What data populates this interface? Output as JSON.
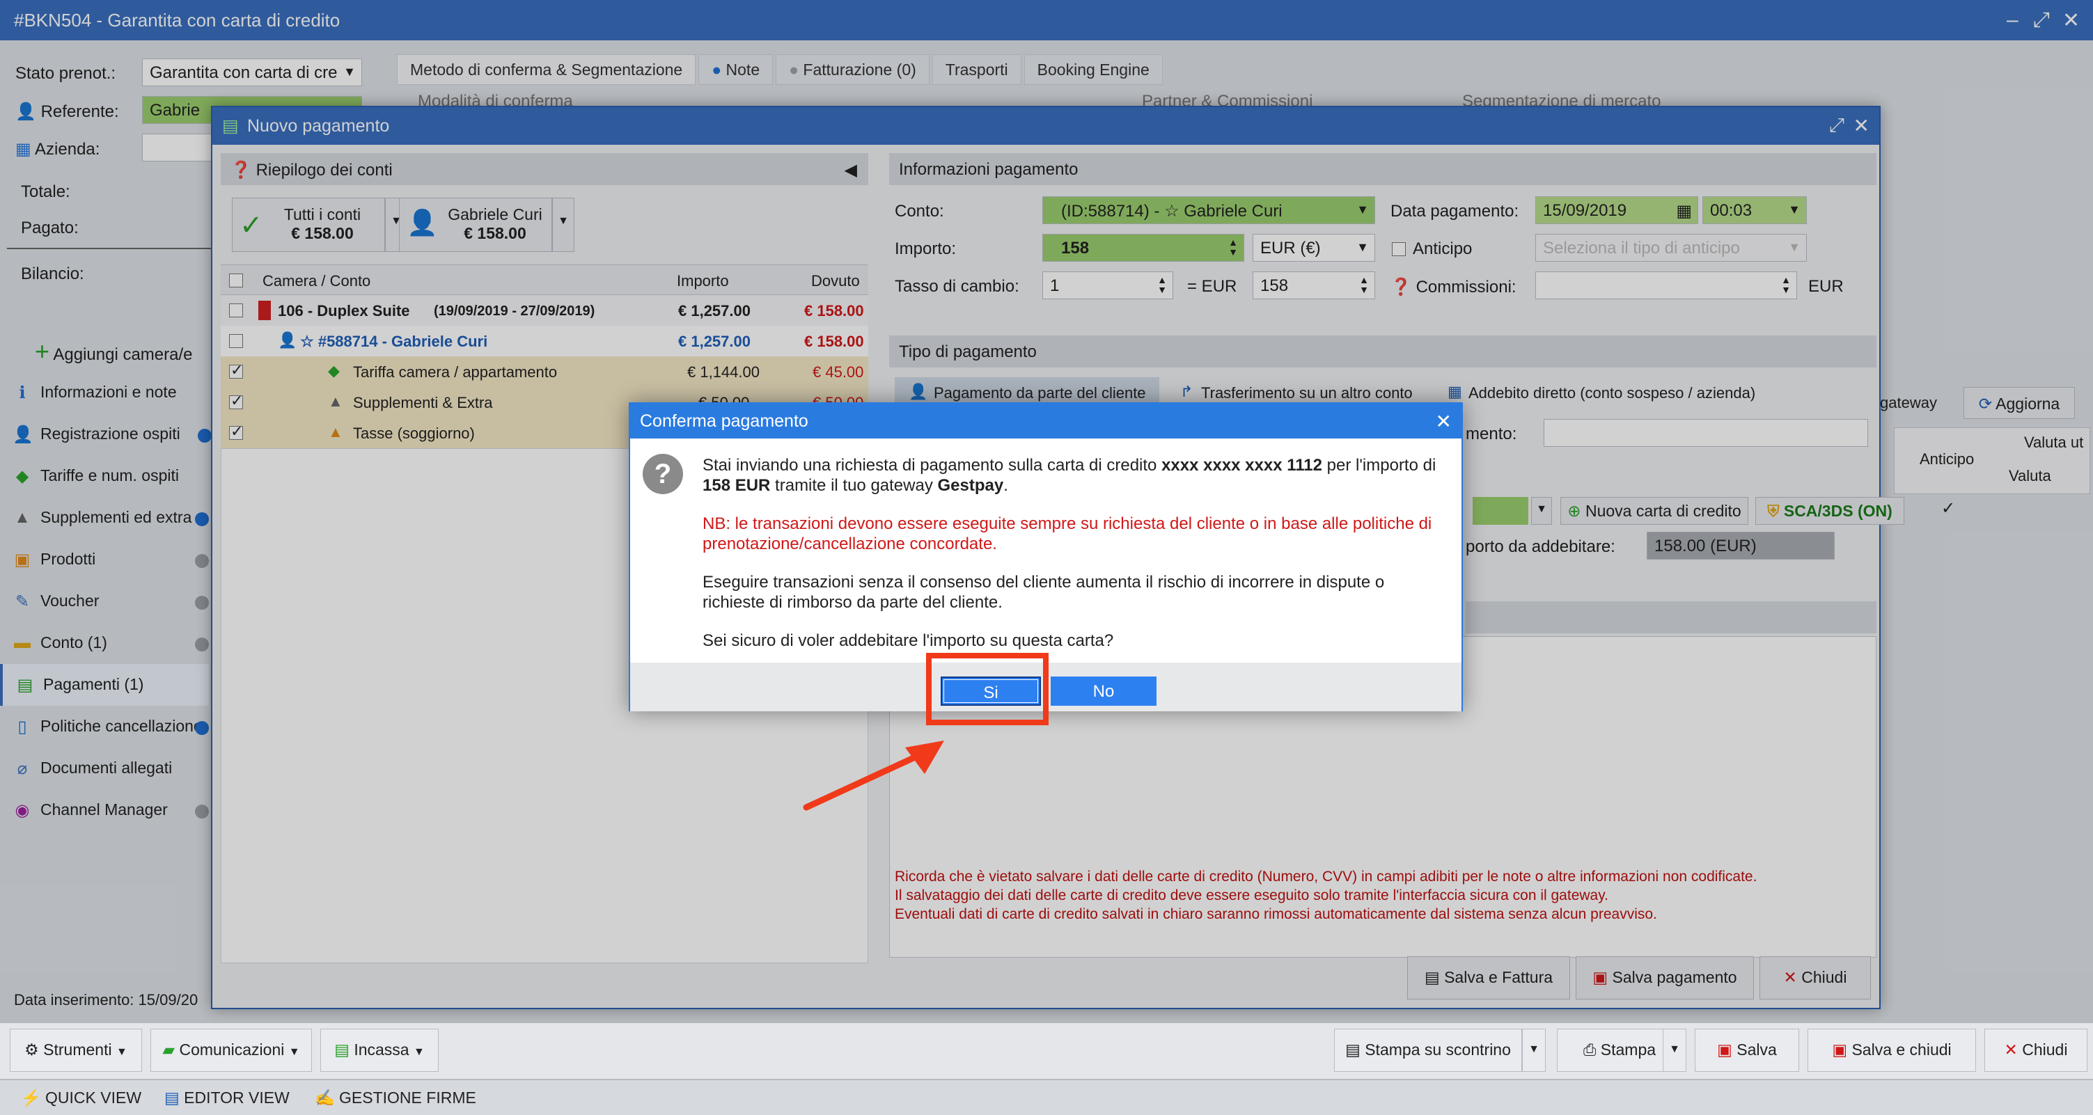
{
  "window": {
    "title": "#BKN504 - Garantita con carta di credito"
  },
  "booking": {
    "stato_label": "Stato prenot.:",
    "stato_value": "Garantita con carta di cre",
    "referente_label": "Referente:",
    "referente_value": "Gabrie",
    "azienda_label": "Azienda:",
    "totale_label": "Totale:",
    "pagato_label": "Pagato:",
    "bilancio_label": "Bilancio:",
    "add_room": "Aggiungi camera/e",
    "data_ins_label": "Data inserimento:",
    "data_ins_value": "15/09/20"
  },
  "tabs": [
    "Metodo di conferma & Segmentazione",
    "Note",
    "Fatturazione (0)",
    "Trasporti",
    "Booking Engine"
  ],
  "bg_sections": {
    "modalita": "Modalità di conferma",
    "partner": "Partner & Commissioni",
    "segmentazione": "Segmentazione di mercato"
  },
  "sidebar": [
    {
      "label": "Informazioni e note"
    },
    {
      "label": "Registrazione ospiti"
    },
    {
      "label": "Tariffe e num. ospiti"
    },
    {
      "label": "Supplementi ed extra"
    },
    {
      "label": "Prodotti"
    },
    {
      "label": "Voucher"
    },
    {
      "label": "Conto (1)"
    },
    {
      "label": "Pagamenti (1)"
    },
    {
      "label": "Politiche cancellazione"
    },
    {
      "label": "Documenti allegati"
    },
    {
      "label": "Channel Manager"
    }
  ],
  "modal": {
    "title": "Nuovo pagamento",
    "riepilogo": "Riepilogo dei conti",
    "tutti": {
      "label": "Tutti i conti",
      "amount": "€ 158.00"
    },
    "gabriele": {
      "label": "Gabriele Curi",
      "amount": "€ 158.00"
    },
    "table_headers": [
      "Camera / Conto",
      "Importo",
      "Dovuto"
    ],
    "rows": [
      {
        "name": "106 - Duplex Suite",
        "dates": "(19/09/2019 - 27/09/2019)",
        "importo": "€ 1,257.00",
        "dovuto": "€ 158.00"
      },
      {
        "name": "☆ #588714 - Gabriele Curi",
        "importo": "€ 1,257.00",
        "dovuto": "€ 158.00"
      },
      {
        "name": "Tariffa camera / appartamento",
        "importo": "€ 1,144.00",
        "dovuto": "€ 45.00"
      },
      {
        "name": "Supplementi & Extra",
        "importo": "€ 50.00",
        "dovuto": "€ 50.00"
      },
      {
        "name": "Tasse (soggiorno)",
        "importo": "",
        "dovuto": ""
      }
    ],
    "info_head": "Informazioni pagamento",
    "conto_label": "Conto:",
    "conto_value": "(ID:588714) - ☆ Gabriele Curi",
    "data_label": "Data pagamento:",
    "data_value": "15/09/2019",
    "time_value": "00:03",
    "importo_label": "Importo:",
    "importo_value": "158",
    "currency": "EUR (€)",
    "anticipo_label": "Anticipo",
    "anticipo_placeholder": "Seleziona il tipo di anticipo",
    "tasso_label": "Tasso di cambio:",
    "tasso_value": "1",
    "eq_eur": "= EUR",
    "tasso_result": "158",
    "commissioni_label": "Commissioni:",
    "commissioni_unit": "EUR",
    "tipo_head": "Tipo di pagamento",
    "pay_tabs": [
      "Pagamento da parte del cliente",
      "Trasferimento su un altro conto",
      "Addebito diretto (conto sospeso / azienda)"
    ],
    "gateway": "gateway",
    "aggiorna": "Aggiorna",
    "mento_label": "mento:",
    "col_anticipo": "Anticipo",
    "col_valuta_ut": "Valuta ut",
    "col_valuta": "Valuta",
    "check_mark": "✓",
    "nuova_carta": "Nuova carta di credito",
    "sca": "SCA/3DS (ON)",
    "addebitare_label": "porto da addebitare:",
    "addebitare_value": "158.00 (EUR)",
    "warning_lines": [
      "Ricorda che è vietato salvare i dati delle carte di credito (Numero, CVV) in campi adibiti per le note o altre informazioni non codificate.",
      "Il salvataggio dei dati delle carte di credito deve essere eseguito solo tramite l'interfaccia sicura con il gateway.",
      "Eventuali dati di carte di credito salvati in chiaro saranno rimossi automaticamente dal sistema senza alcun preavviso."
    ],
    "btn_salva_fattura": "Salva e Fattura",
    "btn_salva_pagamento": "Salva pagamento",
    "btn_chiudi": "Chiudi"
  },
  "dialog": {
    "title": "Conferma pagamento",
    "p1_a": "Stai inviando una richiesta di pagamento sulla carta di credito ",
    "p1_card": "xxxx xxxx xxxx 1112",
    "p1_b": " per l'importo di ",
    "p1_amount": "158 EUR",
    "p1_c": " tramite il tuo gateway ",
    "p1_gateway": "Gestpay",
    "p1_d": ".",
    "p2": "NB: le transazioni devono essere eseguite sempre su richiesta del cliente o in base alle politiche di prenotazione/cancellazione concordate.",
    "p3": "Eseguire transazioni senza il consenso del cliente aumenta il rischio di incorrere in dispute o richieste di rimborso da parte del cliente.",
    "p4": "Sei sicuro di voler addebitare l'importo su questa carta?",
    "yes": "Si",
    "no": "No"
  },
  "bottom": {
    "strumenti": "Strumenti",
    "comunicazioni": "Comunicazioni",
    "incassa": "Incassa",
    "scontrino": "Stampa su scontrino",
    "stampa": "Stampa",
    "salva": "Salva",
    "salva_chiudi": "Salva e chiudi",
    "chiudi": "Chiudi"
  },
  "status": {
    "quick": "QUICK VIEW",
    "editor": "EDITOR VIEW",
    "firme": "GESTIONE FIRME"
  },
  "colors": {
    "accent": "#3a6fc0",
    "dialog": "#2a7be0",
    "annotation": "#f03a1a",
    "green_field": "#9ccf6e"
  }
}
